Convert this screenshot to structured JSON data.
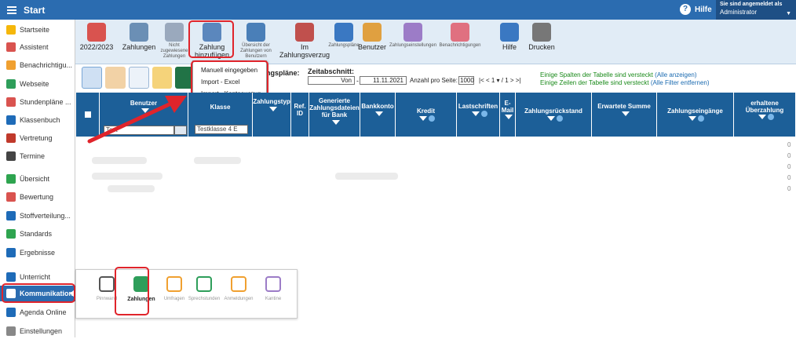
{
  "topbar": {
    "title": "Start",
    "help": "Hilfe",
    "user_line1": "Sie sind angemeldet als",
    "user_line2": "Administrator",
    "help_icon": "question-icon"
  },
  "sidebar": {
    "items": [
      {
        "label": "Startseite",
        "color": "#f5b70b"
      },
      {
        "label": "Assistent",
        "color": "#d9534f"
      },
      {
        "label": "Benachrichtigu...",
        "color": "#f0a030"
      },
      {
        "label": "Webseite",
        "color": "#2e9e5a"
      },
      {
        "label": "Stundenpläne ...",
        "color": "#d9534f"
      },
      {
        "label": "Klassenbuch",
        "color": "#1e6bb8"
      },
      {
        "label": "Vertretung",
        "color": "#c0392b"
      },
      {
        "label": "Termine",
        "color": "#444"
      },
      {
        "label": "Übersicht",
        "color": "#2ea44f"
      },
      {
        "label": "Bewertung",
        "color": "#d9534f"
      },
      {
        "label": "Stoffverteilung...",
        "color": "#1e6bb8"
      },
      {
        "label": "Standards",
        "color": "#2ea44f"
      },
      {
        "label": "Ergebnisse",
        "color": "#1e6bb8"
      },
      {
        "label": "Unterricht",
        "color": "#1e6bb8"
      },
      {
        "label": "Kommunikation",
        "color": "#ffffff"
      },
      {
        "label": "Agenda Online",
        "color": "#1e6bb8"
      },
      {
        "label": "Einstellungen",
        "color": "#888"
      }
    ]
  },
  "ribbon": {
    "buttons": [
      {
        "label": "2022/2023",
        "small": "",
        "color": "#d9534f"
      },
      {
        "label": "Zahlungen",
        "small": "",
        "color": "#6b8fb5"
      },
      {
        "label": "",
        "small": "Nicht zugewiesene Zahlungen",
        "color": "#9aa9bd"
      },
      {
        "label": "Zahlung hinzufügen",
        "small": "",
        "color": "#5b87bd"
      },
      {
        "label": "",
        "small": "Übersicht der Zahlungen von Benutzern",
        "color": "#4a7fb8"
      },
      {
        "label": "Im Zahlungsverzug",
        "small": "",
        "color": "#c0504d"
      },
      {
        "label": "",
        "small": "Zahlungspläne",
        "color": "#3a78c2"
      },
      {
        "label": "Benutzer",
        "small": "",
        "color": "#e0a040"
      },
      {
        "label": "",
        "small": "Zahlungseinstellungen",
        "color": "#9c7cc7"
      },
      {
        "label": "",
        "small": "Benachrichtigungen",
        "color": "#e07080"
      },
      {
        "label": "Hilfe",
        "small": "",
        "color": "#3a78c2"
      },
      {
        "label": "Drucken",
        "small": "",
        "color": "#777"
      }
    ]
  },
  "dropdown": {
    "items": [
      "Manuell eingegeben",
      "Import - Excel",
      "Import - Kontoauszug"
    ]
  },
  "filters": {
    "zahlungsplaene_label": "ngspläne:",
    "zeitabschnitt_label": "Zeitabschnitt:",
    "from": "Von",
    "to": "11.11.2021",
    "per_page_label": "Anzahl pro Seite:",
    "per_page": "1000",
    "pager": "|< <   1 ▾  / 1  > >|",
    "hint1": "Einige Spalten der Tabelle sind versteckt",
    "hint1_link": "(Alle anzeigen)",
    "hint2": "Einige Zeilen der Tabelle sind versteckt",
    "hint2_link": "(Alle Filter entfernen)"
  },
  "table": {
    "columns": [
      {
        "label": "Benutzer"
      },
      {
        "label": "Klasse"
      },
      {
        "label": "Zahlungstyp"
      },
      {
        "label": "Ref. ID"
      },
      {
        "label": "Generierte Zahlungsdateien für Bank"
      },
      {
        "label": "Bankkonto"
      },
      {
        "label": "Kredit"
      },
      {
        "label": "Lastschriften"
      },
      {
        "label": "E-Mail"
      },
      {
        "label": "Zahlungsrückstand"
      },
      {
        "label": "Erwartete Summe"
      },
      {
        "label": "Zahlungseingänge"
      },
      {
        "label": "erhaltene Überzahlung"
      }
    ],
    "user_filter": "Test",
    "class_filter": "Testklasse 4 E",
    "row_values": [
      "0",
      "0",
      "0",
      "0",
      "0"
    ]
  },
  "popup": {
    "items": [
      {
        "label": "Pinnwand",
        "color": "#555"
      },
      {
        "label": "Zahlungen",
        "color": "#2e9e5a"
      },
      {
        "label": "Umfragen",
        "color": "#f0a030"
      },
      {
        "label": "Sprechstunden",
        "color": "#2e9e5a"
      },
      {
        "label": "Anmeldungen",
        "color": "#f0a030"
      },
      {
        "label": "Kantine",
        "color": "#9c7cc7"
      }
    ]
  }
}
